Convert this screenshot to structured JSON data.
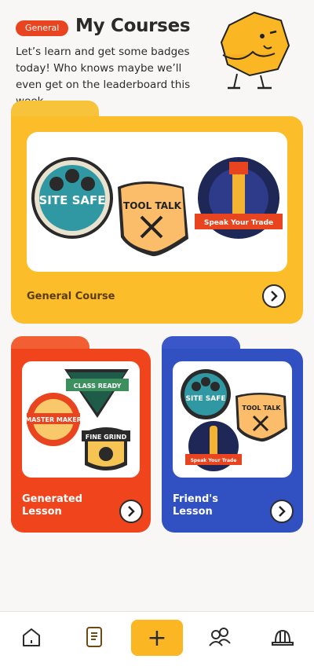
{
  "header": {
    "tag": "General",
    "title": "My Courses",
    "intro": "Let’s learn and get some badges today! Who knows maybe we’ll even get on the leaderboard this week..."
  },
  "cards": {
    "general": {
      "label": "General Course",
      "badges": [
        "SITE SAFE",
        "TOOL TALK",
        "Speak Your Trade"
      ]
    },
    "generated": {
      "label_line1": "Generated",
      "label_line2": "Lesson",
      "badges": [
        "CLASS READY",
        "MASTER MAKER",
        "FINE GRIND"
      ]
    },
    "friends": {
      "label_line1": "Friend's",
      "label_line2": "Lesson",
      "badges": [
        "SITE SAFE",
        "TOOL TALK",
        "Speak Your Trade"
      ]
    }
  },
  "nav": {
    "add_symbol": "+",
    "icons": [
      "home-icon",
      "book-icon",
      "plus-icon",
      "people-icon",
      "hardhat-icon"
    ]
  },
  "colors": {
    "accent_orange": "#e8441f",
    "yellow": "#fbbd2a",
    "red": "#f0451c",
    "blue": "#3150c2"
  }
}
